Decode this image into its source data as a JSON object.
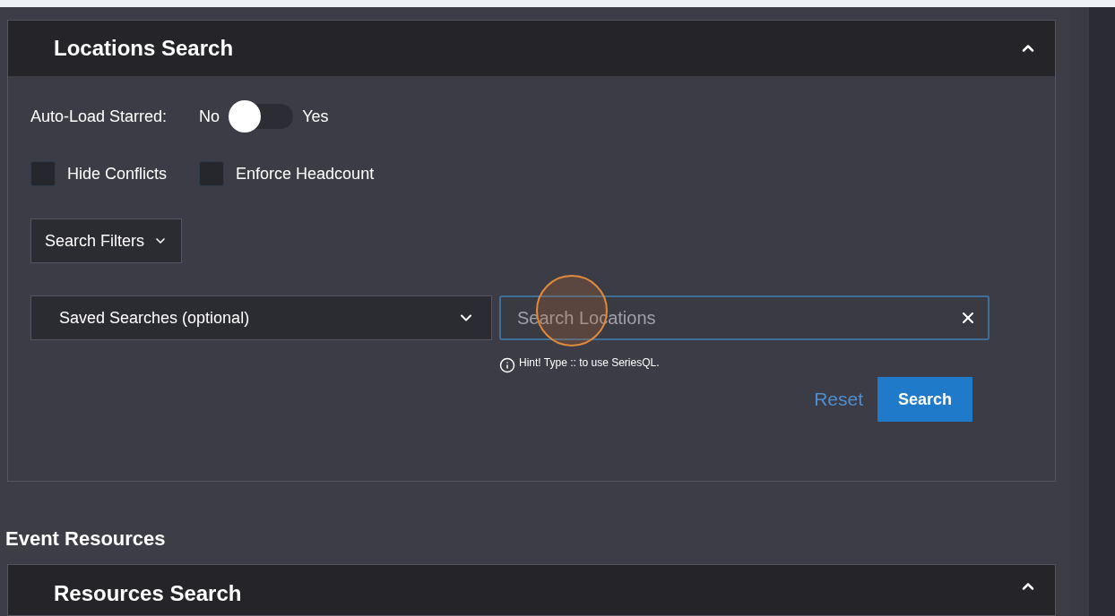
{
  "locations_panel": {
    "title": "Locations Search",
    "expanded": true,
    "auto_load": {
      "label": "Auto-Load Starred:",
      "off_label": "No",
      "on_label": "Yes",
      "on": false
    },
    "checkboxes": [
      {
        "label": "Hide Conflicts",
        "checked": false
      },
      {
        "label": "Enforce Headcount",
        "checked": false
      }
    ],
    "filters_button": "Search Filters",
    "saved_searches": {
      "placeholder": "Saved Searches (optional)"
    },
    "search_field": {
      "placeholder": "Search Locations"
    },
    "hint": "Hint! Type :: to use SeriesQL.",
    "buttons": [
      "Reset",
      "Search"
    ]
  },
  "section_title": "Event Resources",
  "resources_panel": {
    "title": "Resources Search",
    "expanded": true
  }
}
